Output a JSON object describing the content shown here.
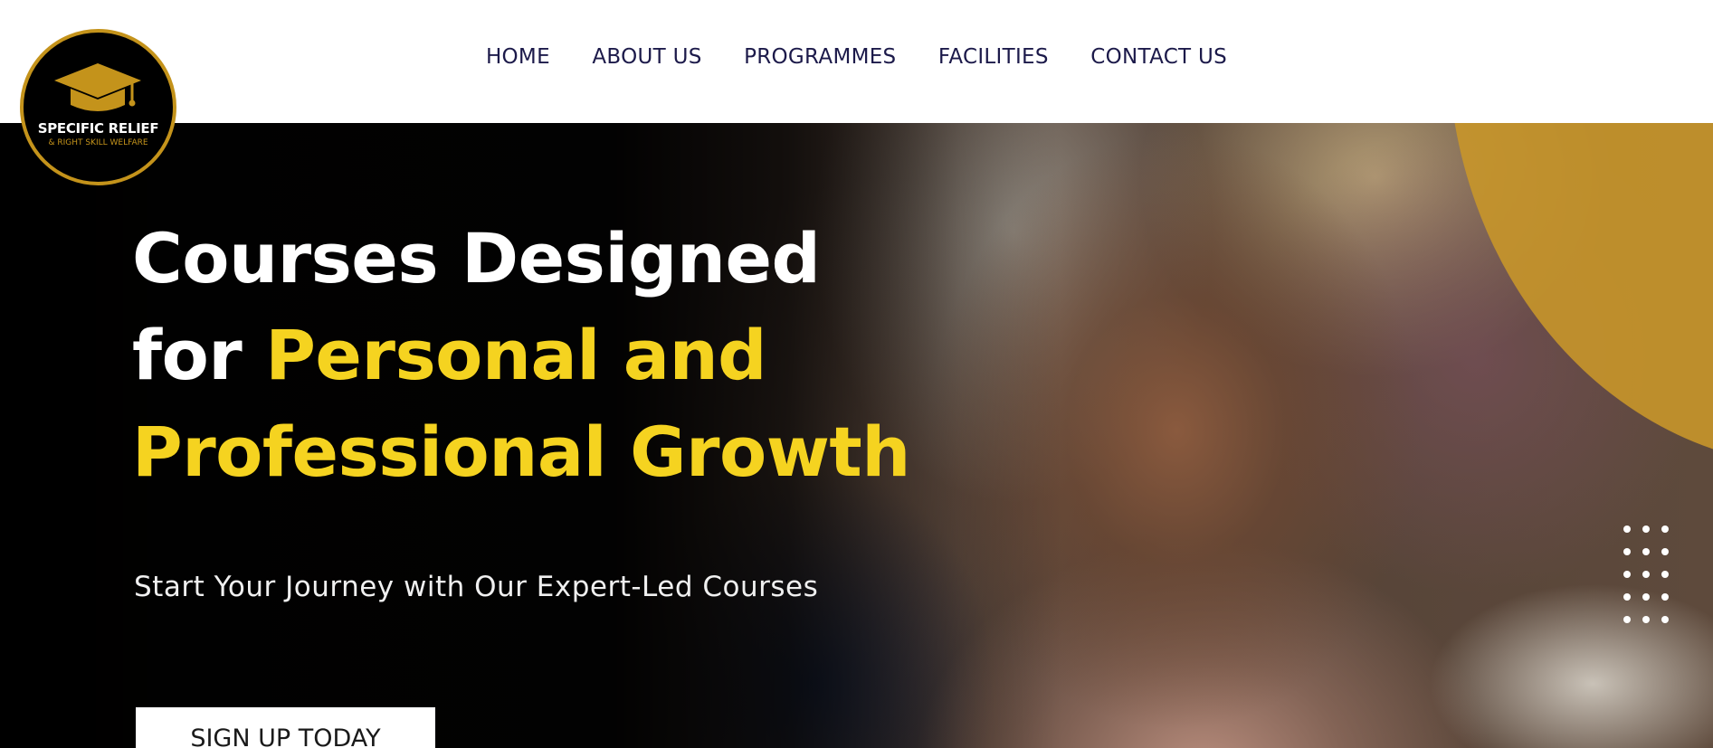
{
  "brand": {
    "name": "SPECIFIC RELIEF",
    "tagline": "& RIGHT SKILL WELFARE",
    "icon": "graduation-cap-icon",
    "gold": "#c4931b"
  },
  "nav": {
    "items": [
      "HOME",
      "ABOUT US",
      "PROGRAMMES",
      "FACILITIES",
      "CONTACT US"
    ]
  },
  "hero": {
    "heading_line1": "Courses Designed",
    "heading_for": "for ",
    "heading_highlight_1": "Personal and",
    "heading_highlight_2": "Professional Growth",
    "subheading": "Start Your Journey with Our Expert-Led Courses",
    "cta_label": "SIGN UP TODAY",
    "highlight_color": "#f5d320",
    "accent_color": "#c8962a"
  }
}
